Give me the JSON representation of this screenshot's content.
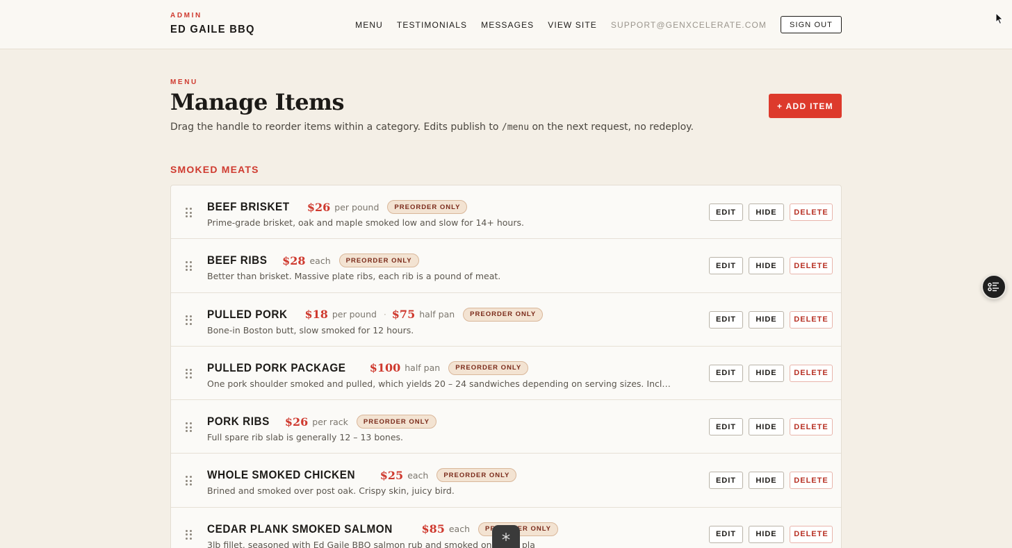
{
  "header": {
    "kicker": "ADMIN",
    "brand": "ED GAILE BBQ",
    "nav": [
      {
        "label": "MENU"
      },
      {
        "label": "TESTIMONIALS"
      },
      {
        "label": "MESSAGES"
      },
      {
        "label": "VIEW SITE"
      },
      {
        "label": "SUPPORT@GENXCELERATE.COM"
      }
    ],
    "sign_out": "SIGN OUT"
  },
  "page": {
    "kicker": "MENU",
    "title": "Manage Items",
    "desc_before": "Drag the handle to reorder items within a category. Edits publish to ",
    "desc_code": "/menu",
    "desc_after": " on the next request, no redeploy.",
    "add_button": "+ ADD ITEM"
  },
  "category": {
    "title": "SMOKED MEATS",
    "items": [
      {
        "name": "BEEF BRISKET",
        "price": "$26",
        "unit": "per pound",
        "badge": "PREORDER ONLY",
        "desc": "Prime-grade brisket, oak and maple smoked low and slow for 14+ hours."
      },
      {
        "name": "BEEF RIBS",
        "price": "$28",
        "unit": "each",
        "badge": "PREORDER ONLY",
        "desc": "Better than brisket. Massive plate ribs, each rib is a pound of meat."
      },
      {
        "name": "PULLED PORK",
        "price": "$18",
        "unit": "per pound",
        "sep": "·",
        "price2": "$75",
        "unit2": "half pan",
        "badge": "PREORDER ONLY",
        "desc": "Bone-in Boston butt, slow smoked for 12 hours."
      },
      {
        "name": "PULLED PORK PACKAGE",
        "price": "$100",
        "unit": "half pan",
        "badge": "PREORDER ONLY",
        "desc": "One pork shoulder smoked and pulled, which yields 20 – 24 sandwiches depending on serving sizes. Includes buns and..."
      },
      {
        "name": "PORK RIBS",
        "price": "$26",
        "unit": "per rack",
        "badge": "PREORDER ONLY",
        "desc": "Full spare rib slab is generally 12 – 13 bones."
      },
      {
        "name": "WHOLE SMOKED CHICKEN",
        "price": "$25",
        "unit": "each",
        "badge": "PREORDER ONLY",
        "desc": "Brined and smoked over post oak. Crispy skin, juicy bird."
      },
      {
        "name": "CEDAR PLANK SMOKED SALMON",
        "price": "$85",
        "unit": "each",
        "badge": "PREORDER ONLY",
        "desc": "3lb fillet, seasoned with Ed Gaile BBQ salmon rub and smoked on cedar pla"
      }
    ]
  },
  "actions": {
    "edit": "EDIT",
    "hide": "HIDE",
    "delete": "DELETE"
  },
  "icons": {
    "drag": "drag-handle-icon",
    "fab": "checklist-icon",
    "dock": "snowflake-icon",
    "cursor": "cursor-icon"
  },
  "colors": {
    "accent": "#dd3a2c",
    "background": "#f4efe6",
    "badge_bg": "#f3e3d2"
  }
}
